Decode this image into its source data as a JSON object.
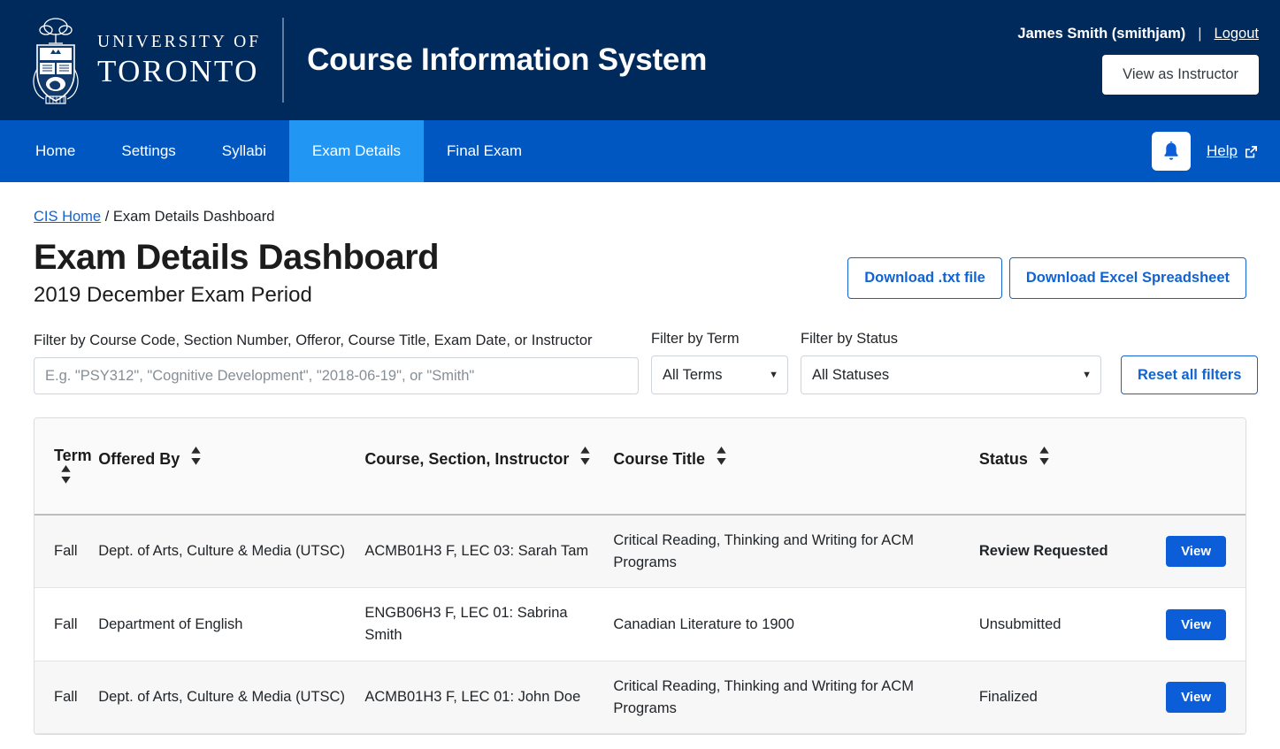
{
  "header": {
    "university_line1": "UNIVERSITY OF",
    "university_line2": "TORONTO",
    "system_title": "Course Information System",
    "user_name": "James Smith (smithjam)",
    "separator": "|",
    "logout_label": "Logout",
    "view_as_instructor_label": "View as Instructor"
  },
  "nav": {
    "items": [
      {
        "label": "Home",
        "active": false
      },
      {
        "label": "Settings",
        "active": false
      },
      {
        "label": "Syllabi",
        "active": false
      },
      {
        "label": "Exam Details",
        "active": true
      },
      {
        "label": "Final Exam",
        "active": false
      }
    ],
    "notifications_icon": "bell-icon",
    "help_label": "Help",
    "help_icon": "external-link-icon"
  },
  "breadcrumb": {
    "home_label": "CIS Home",
    "separator": "/",
    "current_label": "Exam Details Dashboard"
  },
  "page": {
    "title": "Exam Details Dashboard",
    "subtitle": "2019 December Exam Period",
    "download_txt_label": "Download .txt file",
    "download_excel_label": "Download Excel Spreadsheet"
  },
  "filters": {
    "search_label": "Filter by Course Code, Section Number, Offeror, Course Title, Exam Date, or Instructor",
    "search_value": "",
    "search_placeholder": "E.g. \"PSY312\", \"Cognitive Development\", \"2018-06-19\", or \"Smith\"",
    "term_label": "Filter by Term",
    "term_value": "All Terms",
    "term_options": [
      "All Terms"
    ],
    "status_label": "Filter by Status",
    "status_value": "All Statuses",
    "status_options": [
      "All Statuses"
    ],
    "reset_label": "Reset all filters"
  },
  "table": {
    "columns": [
      {
        "label": "Term",
        "sortable": true
      },
      {
        "label": "Offered By",
        "sortable": true
      },
      {
        "label": "Course, Section, Instructor",
        "sortable": true
      },
      {
        "label": "Course Title",
        "sortable": true
      },
      {
        "label": "Status",
        "sortable": true
      },
      {
        "label": "",
        "sortable": false
      }
    ],
    "action_label": "View",
    "rows": [
      {
        "term": "Fall",
        "offered_by": "Dept. of Arts, Culture & Media (UTSC)",
        "course": "ACMB01H3 F, LEC 03: Sarah Tam",
        "title": "Critical Reading, Thinking and Writing for ACM Programs",
        "status": "Review Requested",
        "status_bold": true,
        "shaded": true
      },
      {
        "term": "Fall",
        "offered_by": "Department of English",
        "course": "ENGB06H3 F, LEC 01: Sabrina Smith",
        "title": "Canadian Literature to 1900",
        "status": "Unsubmitted",
        "status_bold": false,
        "shaded": false
      },
      {
        "term": "Fall",
        "offered_by": "Dept. of Arts, Culture & Media (UTSC)",
        "course": "ACMB01H3 F, LEC 01: John Doe",
        "title": "Critical Reading, Thinking and Writing for ACM Programs",
        "status": "Finalized",
        "status_bold": false,
        "shaded": true
      }
    ]
  },
  "colors": {
    "header_navy": "#002a5c",
    "nav_blue": "#0057c2",
    "active_tab_blue": "#2196f3",
    "link_blue": "#1263d2",
    "button_blue": "#0b5ed7"
  }
}
